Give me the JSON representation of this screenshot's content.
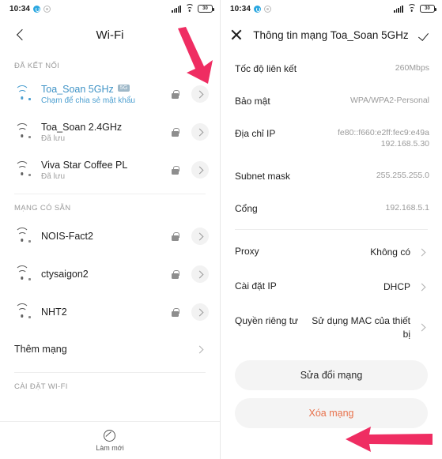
{
  "status_bar": {
    "time": "10:34",
    "battery": "30",
    "icons": [
      "clock-icon",
      "dnd-icon",
      "signal-icon",
      "wifi-icon",
      "battery-icon"
    ]
  },
  "left": {
    "header": {
      "title": "Wi-Fi",
      "back": "back-chevron"
    },
    "connected_label": "ĐÃ KẾT NỐI",
    "available_label": "MẠNG CÓ SẴN",
    "settings_label": "CÀI ĐẶT WI-FI",
    "connected": [
      {
        "ssid": "Toa_Soan 5GHz",
        "badge": "5G",
        "sub": "Chạm để chia sẻ mật khẩu",
        "locked": true,
        "active": true
      },
      {
        "ssid": "Toa_Soan 2.4GHz",
        "badge": "",
        "sub": "Đã lưu",
        "locked": true,
        "active": false
      },
      {
        "ssid": "Viva Star Coffee PL",
        "badge": "",
        "sub": "Đã lưu",
        "locked": true,
        "active": false
      }
    ],
    "available": [
      {
        "ssid": "NOIS-Fact2",
        "badge": "",
        "sub": "",
        "locked": true,
        "active": false
      },
      {
        "ssid": "ctysaigon2",
        "badge": "",
        "sub": "",
        "locked": true,
        "active": false
      },
      {
        "ssid": "NHT2",
        "badge": "",
        "sub": "",
        "locked": true,
        "active": false
      }
    ],
    "add_network": "Thêm mạng",
    "bottom_bar": {
      "refresh_label": "Làm mới"
    }
  },
  "right": {
    "header": {
      "title": "Thông tin mạng Toa_Soan 5GHz",
      "close": "close-icon",
      "confirm": "check-icon"
    },
    "info": [
      {
        "key": "Tốc độ liên kết",
        "value": "260Mbps",
        "value2": "",
        "chevron": false
      },
      {
        "key": "Bảo mật",
        "value": "WPA/WPA2-Personal",
        "value2": "",
        "chevron": false
      },
      {
        "key": "Địa chỉ  IP",
        "value": "fe80::f660:e2ff:fec9:e49a",
        "value2": "192.168.5.30",
        "chevron": false
      },
      {
        "key": "Subnet mask",
        "value": "255.255.255.0",
        "value2": "",
        "chevron": false
      },
      {
        "key": "Cổng",
        "value": "192.168.5.1",
        "value2": "",
        "chevron": false
      }
    ],
    "actions": [
      {
        "key": "Proxy",
        "value": "Không có",
        "value2": "",
        "chevron": true
      },
      {
        "key": "Cài đặt IP",
        "value": "DHCP",
        "value2": "",
        "chevron": true
      },
      {
        "key": "Quyền riêng tư",
        "value": "Sử dụng MAC của thiết bị",
        "value2": "",
        "chevron": true
      }
    ],
    "modify_button": "Sửa đổi mạng",
    "forget_button": "Xóa mạng"
  },
  "annotations": {
    "arrow_color": "#ef2d62",
    "arrows": [
      "arrow-to-network-detail",
      "arrow-to-forget-network"
    ]
  }
}
